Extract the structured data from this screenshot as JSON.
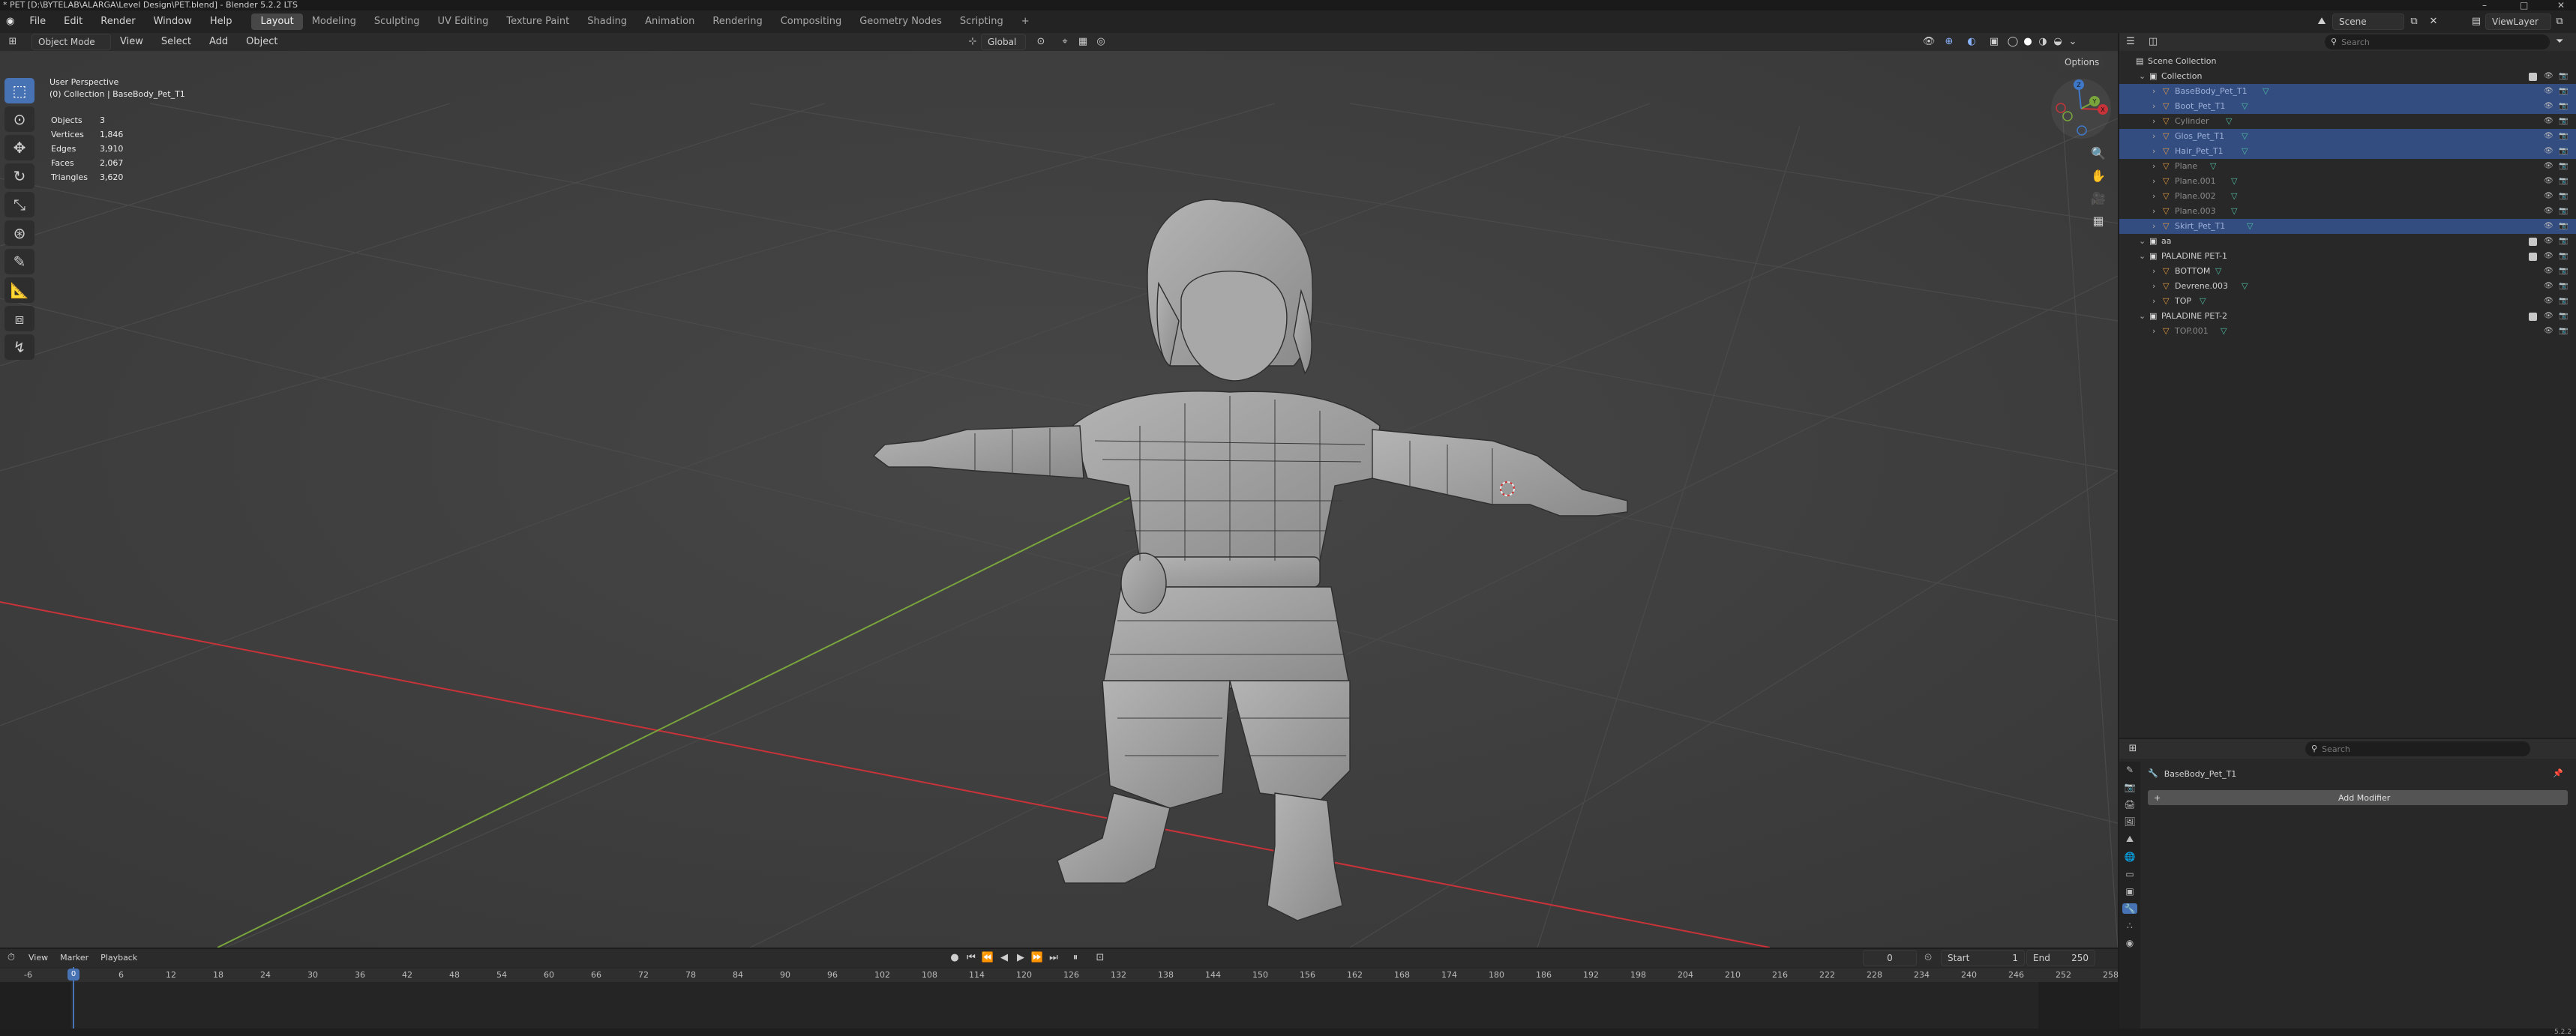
{
  "window": {
    "title": "* PET [D:\\BYTELAB\\ALARGA\\Level Design\\PET.blend] - Blender 5.2.2 LTS",
    "controls": [
      "–",
      "□",
      "✕"
    ]
  },
  "menu": [
    "File",
    "Edit",
    "Render",
    "Window",
    "Help"
  ],
  "workspaces": {
    "active": "Layout",
    "items": [
      "Layout",
      "Modeling",
      "Sculpting",
      "UV Editing",
      "Texture Paint",
      "Shading",
      "Animation",
      "Rendering",
      "Compositing",
      "Geometry Nodes",
      "Scripting"
    ],
    "add_label": "+"
  },
  "scene": {
    "label": "Scene",
    "view_layer": "ViewLayer"
  },
  "viewport_header": {
    "mode": "Object Mode",
    "menus": [
      "View",
      "Select",
      "Add",
      "Object"
    ],
    "transform_orientation": "Global",
    "options_label": "Options"
  },
  "viewport_overlay": {
    "perspective": "User Perspective",
    "collection_line": "(0) Collection | BaseBody_Pet_T1",
    "stats": [
      {
        "label": "Objects",
        "value": "3"
      },
      {
        "label": "Vertices",
        "value": "1,846"
      },
      {
        "label": "Edges",
        "value": "3,910"
      },
      {
        "label": "Faces",
        "value": "2,067"
      },
      {
        "label": "Triangles",
        "value": "3,620"
      }
    ]
  },
  "gizmo": {
    "x": "X",
    "y": "Y",
    "z": "Z"
  },
  "tools": [
    "select-box",
    "cursor",
    "move",
    "rotate",
    "scale",
    "transform",
    "annotate",
    "measure",
    "add-cube",
    "spin"
  ],
  "outliner": {
    "search_placeholder": "Search",
    "rows": [
      {
        "label": "Scene Collection",
        "depth": 0,
        "type": "scene",
        "selected": false
      },
      {
        "label": "Collection",
        "depth": 1,
        "type": "collection",
        "selected": false
      },
      {
        "label": "BaseBody_Pet_T1",
        "depth": 2,
        "type": "mesh",
        "selected": true,
        "dim": true
      },
      {
        "label": "Boot_Pet_T1",
        "depth": 2,
        "type": "mesh",
        "selected": true,
        "dim": true
      },
      {
        "label": "Cylinder",
        "depth": 2,
        "type": "mesh",
        "selected": false,
        "dim": true
      },
      {
        "label": "Glos_Pet_T1",
        "depth": 2,
        "type": "mesh",
        "selected": true,
        "dim": true
      },
      {
        "label": "Hair_Pet_T1",
        "depth": 2,
        "type": "mesh",
        "selected": true,
        "dim": true
      },
      {
        "label": "Plane",
        "depth": 2,
        "type": "mesh",
        "selected": false,
        "dim": true
      },
      {
        "label": "Plane.001",
        "depth": 2,
        "type": "mesh",
        "selected": false,
        "dim": true
      },
      {
        "label": "Plane.002",
        "depth": 2,
        "type": "mesh",
        "selected": false,
        "dim": true
      },
      {
        "label": "Plane.003",
        "depth": 2,
        "type": "mesh",
        "selected": false,
        "dim": true
      },
      {
        "label": "Skirt_Pet_T1",
        "depth": 2,
        "type": "mesh",
        "selected": true,
        "dim": true
      },
      {
        "label": "aa",
        "depth": 1,
        "type": "collection",
        "selected": false
      },
      {
        "label": "PALADINE PET-1",
        "depth": 1,
        "type": "collection",
        "selected": false
      },
      {
        "label": "BOTTOM",
        "depth": 2,
        "type": "mesh",
        "selected": false
      },
      {
        "label": "Devrene.003",
        "depth": 2,
        "type": "mesh",
        "selected": false
      },
      {
        "label": "TOP",
        "depth": 2,
        "type": "mesh",
        "selected": false
      },
      {
        "label": "PALADINE PET-2",
        "depth": 1,
        "type": "collection",
        "selected": false
      },
      {
        "label": "TOP.001",
        "depth": 2,
        "type": "mesh",
        "selected": false,
        "dim": true
      }
    ]
  },
  "properties": {
    "search_placeholder": "Search",
    "object_name": "BaseBody_Pet_T1",
    "add_modifier_label": "Add Modifier"
  },
  "timeline": {
    "menus": [
      "View",
      "Marker",
      "Playback"
    ],
    "current_frame": "0",
    "start_label": "Start",
    "start_value": "1",
    "end_label": "End",
    "end_value": "250",
    "ruler": [
      "-6",
      "0",
      "6",
      "12",
      "18",
      "24",
      "30",
      "36",
      "42",
      "48",
      "54",
      "60",
      "66",
      "72",
      "78",
      "84",
      "90",
      "96",
      "102",
      "108",
      "114",
      "120",
      "126",
      "132",
      "138",
      "144",
      "150",
      "156",
      "162",
      "168",
      "174",
      "180",
      "186",
      "192",
      "198",
      "204",
      "210",
      "216",
      "222",
      "228",
      "234",
      "240",
      "246",
      "252",
      "258"
    ]
  },
  "status": {
    "version": "5.2.2"
  },
  "colors": {
    "viewport_bg": "#3d3d3d",
    "selection": "#334d80",
    "accent": "#4772b3",
    "x_axis": "#c8333a",
    "y_axis": "#7aa53c",
    "z_axis": "#3f78c9",
    "playhead": "#4772b3"
  }
}
